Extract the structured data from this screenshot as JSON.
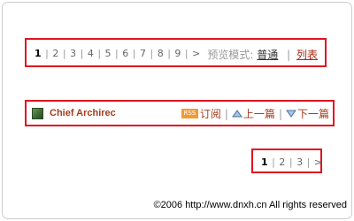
{
  "top_pager": {
    "current": "1",
    "pages": [
      "2",
      "3",
      "4",
      "5",
      "6",
      "7",
      "8",
      "9"
    ],
    "next": ">",
    "separator": "|"
  },
  "preview_mode": {
    "label": "预览模式:",
    "normal": "普通",
    "bar": "|",
    "list": "列表"
  },
  "article_nav": {
    "site_name": "Chief Archirec",
    "rss_badge": "RSS",
    "subscribe": "订阅",
    "separator": "|",
    "prev": "上一篇",
    "next": "下一篇"
  },
  "bottom_pager": {
    "current": "1",
    "pages": [
      "2",
      "3"
    ],
    "next": ">",
    "separator": "|"
  },
  "footer": {
    "copyright": "©2006 http://www.dnxh.cn All rights reserved"
  },
  "colors": {
    "highlight_border": "#e0141e",
    "link": "#a63c1e",
    "rss": "#f29a33"
  }
}
